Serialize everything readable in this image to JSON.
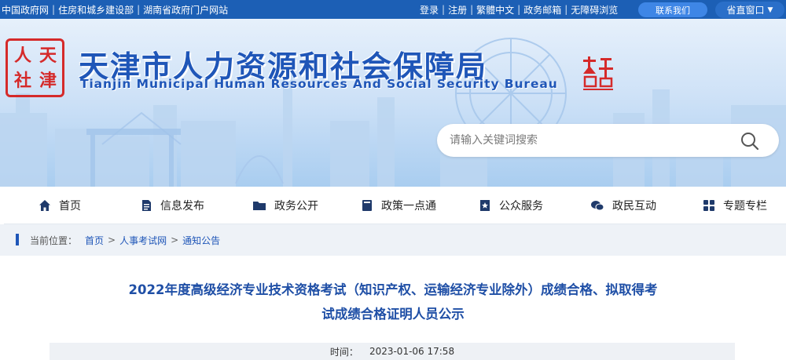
{
  "topbar": {
    "left_links": [
      "中国政府网",
      "住房和城乡建设部",
      "湖南省政府门户网站"
    ],
    "right_links": [
      "登录",
      "注册",
      "繁體中文",
      "政务邮箱",
      "无障碍浏览"
    ],
    "contact_label": "联系我们",
    "province_label": "省直窗口"
  },
  "header": {
    "seal_left_chars": [
      "人",
      "天",
      "社",
      "津"
    ],
    "title_cn": "天津市人力资源和社会保障局",
    "title_en": "Tianjin Municipal Human Resources And Social Security Bureau"
  },
  "search": {
    "placeholder": "请输入关键词搜索"
  },
  "nav": {
    "items": [
      {
        "label": "首页",
        "icon": "home-icon"
      },
      {
        "label": "信息发布",
        "icon": "document-icon"
      },
      {
        "label": "政务公开",
        "icon": "folder-icon"
      },
      {
        "label": "政策一点通",
        "icon": "book-icon"
      },
      {
        "label": "公众服务",
        "icon": "star-bookmark-icon"
      },
      {
        "label": "政民互动",
        "icon": "chat-icon"
      },
      {
        "label": "专题专栏",
        "icon": "grid-icon"
      }
    ]
  },
  "breadcrumb": {
    "label": "当前位置：",
    "items": [
      "首页",
      "人事考试网",
      "通知公告"
    ]
  },
  "article": {
    "title_line1": "2022年度高级经济专业技术资格考试（知识产权、运输经济专业除外）成绩合格、拟取得考",
    "title_line2": "试成绩合格证明人员公示",
    "time_label": "时间：",
    "time_value": "2023-01-06 17:58"
  },
  "colors": {
    "topbar": "#1c5fb5",
    "brand_blue": "#1f56b8",
    "seal_red": "#d52a2a"
  }
}
